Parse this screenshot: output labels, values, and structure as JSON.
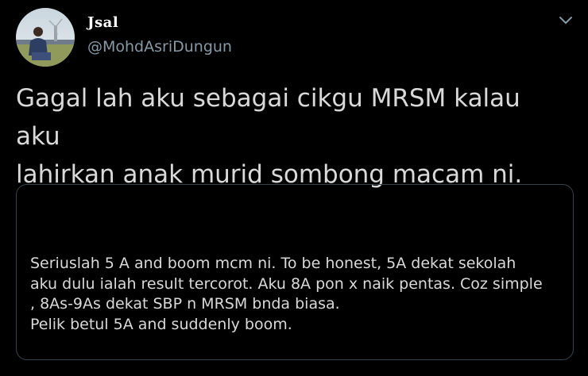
{
  "author": {
    "display_name": "Jsal",
    "handle": "@MohdAsriDungun",
    "avatar_icon": "profile-photo"
  },
  "tweet": {
    "text": "Gagal lah aku sebagai cikgu MRSM kalau aku\nlahirkan anak murid sombong macam ni."
  },
  "quoted_card": {
    "lines": [
      "Seriuslah 5 A and boom mcm ni. To be honest, 5A dekat sekolah",
      "aku dulu ialah result tercorot. Aku 8A pon x naik pentas. Coz simple",
      ", 8As-9As dekat SBP n MRSM bnda biasa.",
      "Pelik betul 5A and suddenly boom."
    ]
  },
  "colors": {
    "background": "#000000",
    "text": "#d9d9d9",
    "secondary_text": "#8899a6",
    "border": "#38444d"
  },
  "icons": {
    "menu": "chevron-down-icon"
  }
}
